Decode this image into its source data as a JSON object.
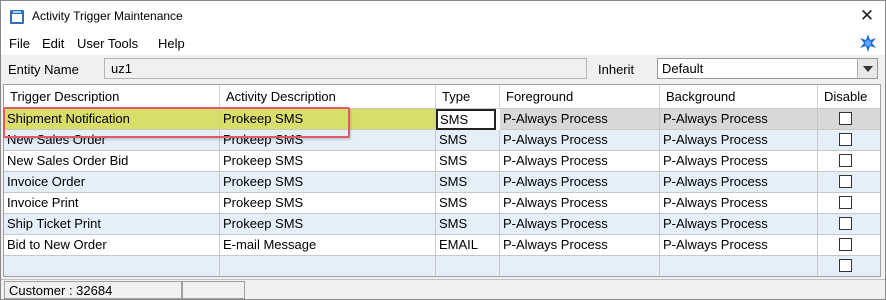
{
  "window": {
    "title": "Activity Trigger Maintenance"
  },
  "icons": {
    "app": "app-window-icon",
    "close": "close-icon",
    "help": "help-star-icon",
    "dropdown": "chevron-down-icon"
  },
  "menu": [
    "File",
    "Edit",
    "User Tools",
    "Help"
  ],
  "entity": {
    "label": "Entity Name",
    "value": "uz1"
  },
  "inherit": {
    "label": "Inherit",
    "value": "Default"
  },
  "columns": [
    "Trigger Description",
    "Activity Description",
    "Type",
    "Foreground",
    "Background",
    "Disable"
  ],
  "rows": [
    {
      "trigger": "Shipment Notification",
      "activity": "Prokeep SMS",
      "type": "SMS",
      "foreground": "P-Always Process",
      "background": "P-Always Process",
      "disable": false
    },
    {
      "trigger": "New Sales Order",
      "activity": "Prokeep SMS",
      "type": "SMS",
      "foreground": "P-Always Process",
      "background": "P-Always Process",
      "disable": false
    },
    {
      "trigger": "New Sales Order Bid",
      "activity": "Prokeep SMS",
      "type": "SMS",
      "foreground": "P-Always Process",
      "background": "P-Always Process",
      "disable": false
    },
    {
      "trigger": "Invoice Order",
      "activity": "Prokeep SMS",
      "type": "SMS",
      "foreground": "P-Always Process",
      "background": "P-Always Process",
      "disable": false
    },
    {
      "trigger": "Invoice Print",
      "activity": "Prokeep SMS",
      "type": "SMS",
      "foreground": "P-Always Process",
      "background": "P-Always Process",
      "disable": false
    },
    {
      "trigger": "Ship Ticket Print",
      "activity": "Prokeep SMS",
      "type": "SMS",
      "foreground": "P-Always Process",
      "background": "P-Always Process",
      "disable": false
    },
    {
      "trigger": "Bid to New Order",
      "activity": "E-mail Message",
      "type": "EMAIL",
      "foreground": "P-Always Process",
      "background": "P-Always Process",
      "disable": false
    },
    {
      "trigger": "",
      "activity": "",
      "type": "",
      "foreground": "",
      "background": "",
      "disable": false
    }
  ],
  "status": {
    "customer": "Customer : 32684",
    "panel2": ""
  },
  "colors": {
    "selected_row": "#d8d8d8",
    "highlight_fill": "#d9dd6a",
    "alt_row": "#e4effa",
    "callout_border": "#e25a6a",
    "help_star": "#1f6fd1"
  }
}
